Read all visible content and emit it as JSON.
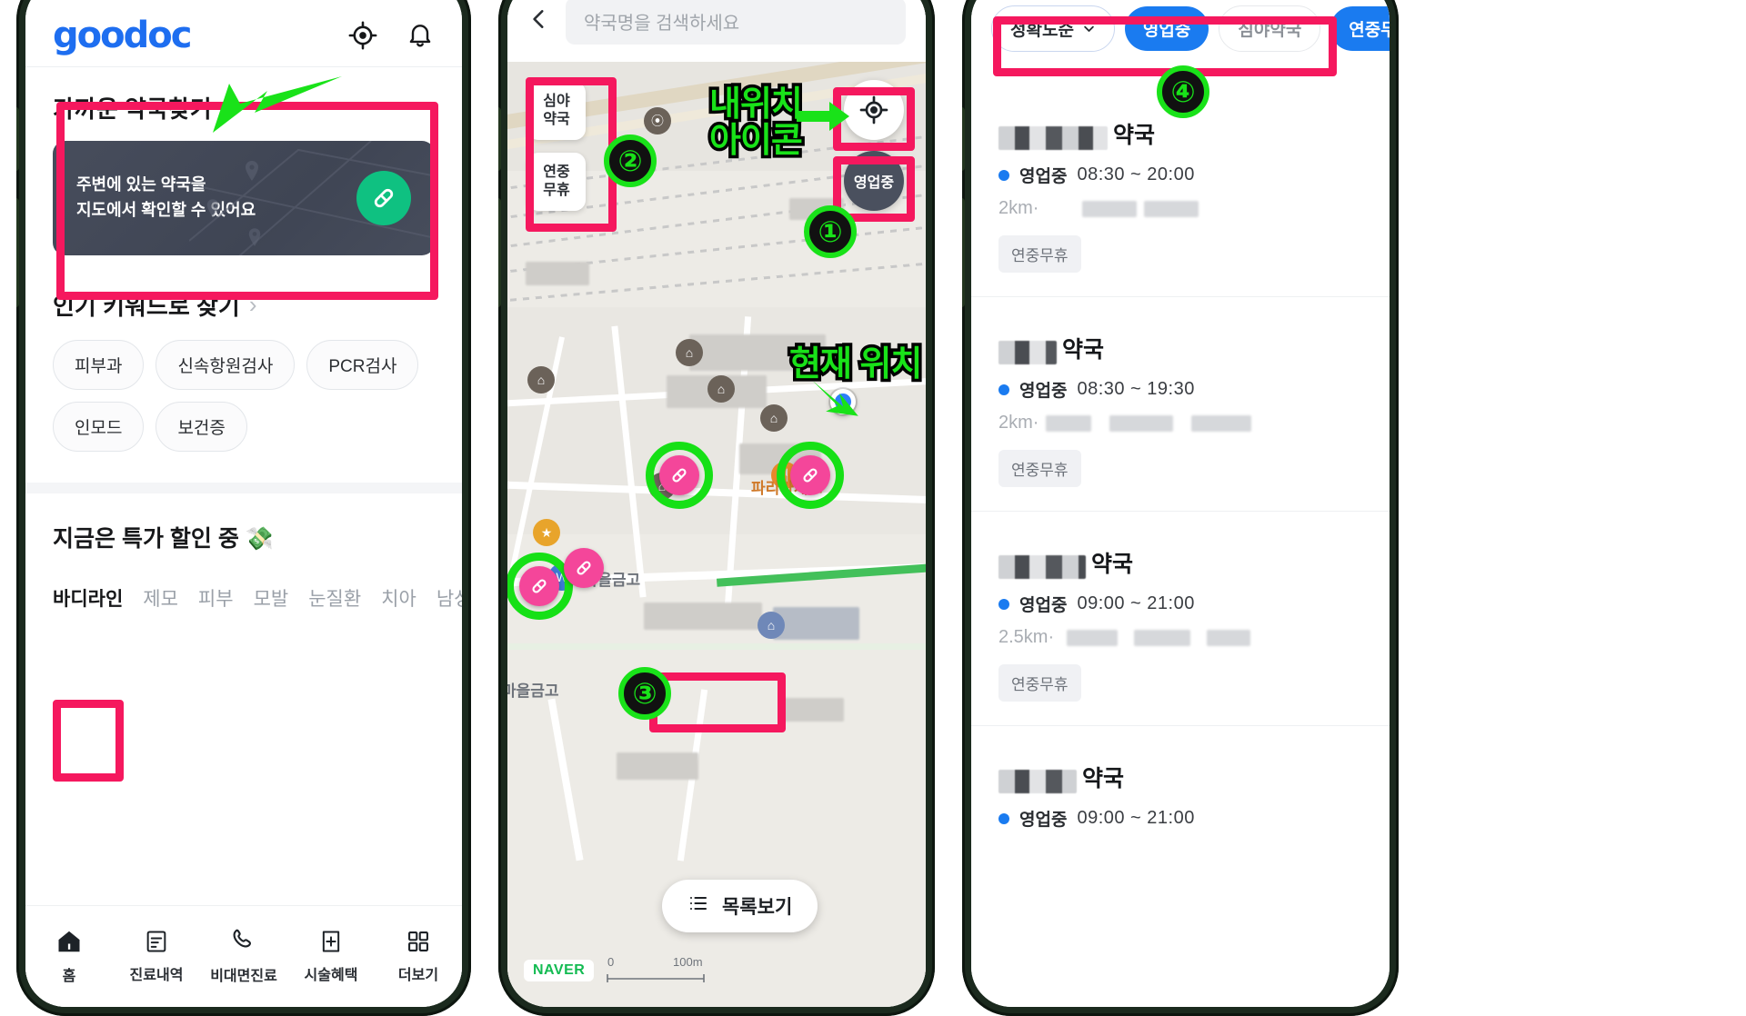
{
  "phone1": {
    "logo": "goodoc",
    "header_icons": [
      "target-icon",
      "bell-icon"
    ],
    "nearby_section": {
      "title": "가까운 약국찾기",
      "chevron": "›",
      "card_line1": "주변에 있는 약국을",
      "card_line2": "지도에서 확인할 수 있어요",
      "card_icon": "pill-icon"
    },
    "keyword_section": {
      "title": "인기 키워드로 찾기",
      "chevron": "›",
      "chips": [
        "피부과",
        "신속항원검사",
        "PCR검사",
        "인모드",
        "보건증"
      ]
    },
    "promo": {
      "title": "지금은 특가 할인 중 💸",
      "tabs": [
        "바디라인",
        "제모",
        "피부",
        "모발",
        "눈질환",
        "치아",
        "남성성"
      ],
      "active_tab": "바디라인"
    },
    "bottom_nav": [
      {
        "label": "홈",
        "icon": "home-icon",
        "active": true
      },
      {
        "label": "진료내역",
        "icon": "document-icon",
        "active": false
      },
      {
        "label": "비대면진료",
        "icon": "phone-icon",
        "active": false
      },
      {
        "label": "시술혜택",
        "icon": "plus-box-icon",
        "active": false
      },
      {
        "label": "더보기",
        "icon": "grid-icon",
        "active": false
      }
    ]
  },
  "phone2": {
    "back_icon": "chevron-left-icon",
    "search_placeholder": "약국명을 검색하세요",
    "side_buttons": [
      {
        "line1": "심야",
        "line2": "약국"
      },
      {
        "line1": "연중",
        "line2": "무휴"
      }
    ],
    "my_location_icon": "crosshair-icon",
    "open_now_button": "영업중",
    "list_button": {
      "label": "목록보기",
      "icon": "list-icon"
    },
    "map_labels": [
      "파리바게뜨",
      "새마을금고",
      "마을금고"
    ],
    "map_attribution": "NAVER",
    "scale": {
      "zero": "0",
      "dist": "100m"
    }
  },
  "phone3": {
    "filters": [
      {
        "label": "정확도순",
        "style": "outline",
        "icon": "chevron-down-icon"
      },
      {
        "label": "영업중",
        "style": "blue"
      },
      {
        "label": "심야약국",
        "style": "plain"
      },
      {
        "label": "연중무휴",
        "style": "blue"
      }
    ],
    "items": [
      {
        "name_suffix": "약국",
        "status": "영업중",
        "hours": "08:30 ~ 20:00",
        "distance": "2km·",
        "tag": "연중무휴"
      },
      {
        "name_suffix": "약국",
        "status": "영업중",
        "hours": "08:30 ~ 19:30",
        "distance": "2km·",
        "tag": "연중무휴"
      },
      {
        "name_suffix": "약국",
        "status": "영업중",
        "hours": "09:00 ~ 21:00",
        "distance": "2.5km·",
        "tag": "연중무휴"
      },
      {
        "name_suffix": "약국",
        "status": "영업중",
        "hours": "09:00 ~ 21:00",
        "distance": "",
        "tag": ""
      }
    ]
  },
  "annotations": {
    "numbers": [
      "①",
      "②",
      "③",
      "④"
    ],
    "labels": {
      "my_location_icon_l1": "내위치",
      "my_location_icon_l2": "아이콘",
      "current_position": "현재 위치"
    },
    "box_color": "#f5185e",
    "accent_color": "#19e219"
  }
}
